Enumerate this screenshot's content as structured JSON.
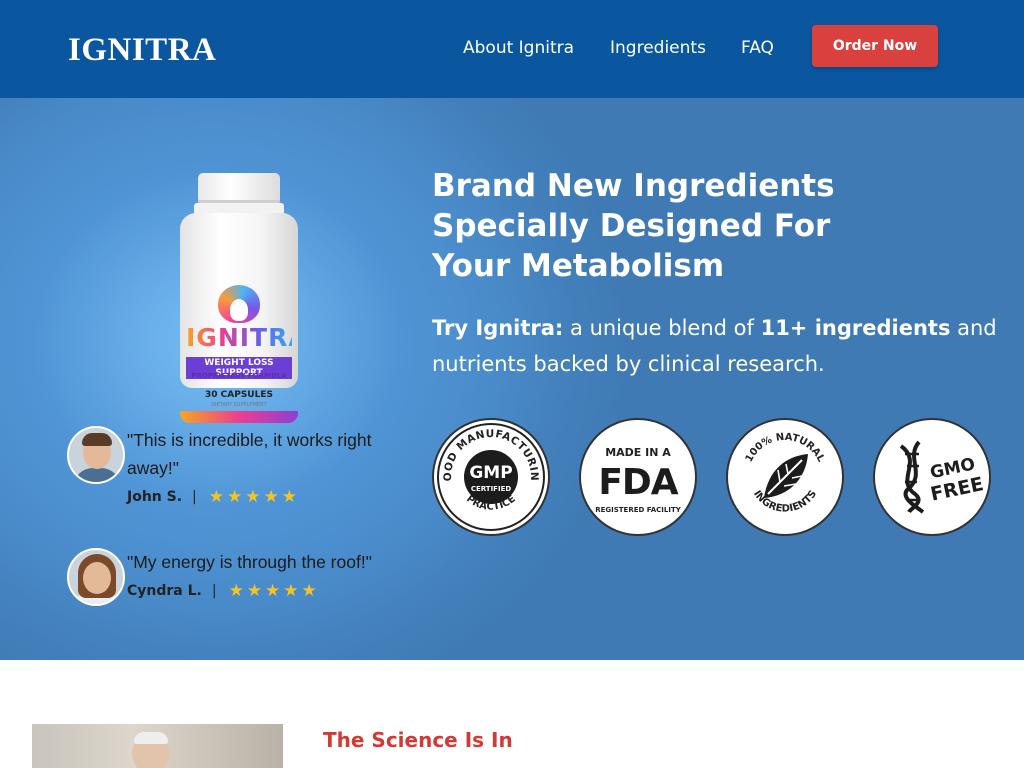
{
  "header": {
    "logo": "IGNITRA",
    "nav": [
      {
        "label": "About Ignitra"
      },
      {
        "label": "Ingredients"
      },
      {
        "label": "FAQ"
      }
    ],
    "cta_label": "Order Now"
  },
  "product": {
    "brand": "IGNITRA",
    "line1": "WEIGHT LOSS SUPPORT",
    "line2": "PROPRIETARY FORMULA",
    "capsules": "30 CAPSULES",
    "supplement": "DIETARY SUPPLEMENT"
  },
  "testimonials": [
    {
      "quote": "\"This is incredible, it works right away!\"",
      "author": "John S.",
      "separator": "|",
      "rating": 5,
      "stars": "★★★★★"
    },
    {
      "quote": "\"My energy is through the roof!\"",
      "author": "Cyndra L.",
      "separator": "|",
      "rating": 5,
      "stars": "★★★★★"
    }
  ],
  "hero": {
    "headline": "Brand New Ingredients Specially Designed For Your Metabolism",
    "lead_prefix": "Try Ignitra:",
    "lead_mid": " a unique blend of ",
    "lead_bold": "11+ ingredients",
    "lead_suffix": " and nutrients backed by clinical research."
  },
  "badges": [
    {
      "name": "gmp-certified-badge",
      "top_arc": "GOOD MANUFACTURING",
      "bottom_arc": "PRACTICE",
      "center_line1": "GMP",
      "center_line2": "CERTIFIED"
    },
    {
      "name": "fda-badge",
      "top_text": "MADE IN A",
      "center": "FDA",
      "bottom_text": "REGISTERED FACILITY"
    },
    {
      "name": "natural-ingredients-badge",
      "top_arc": "100% NATURAL",
      "bottom_arc": "INGREDIENTS"
    },
    {
      "name": "gmo-free-badge",
      "line1": "GMO",
      "line2": "FREE"
    }
  ],
  "science": {
    "title": "The Science Is In"
  },
  "colors": {
    "header_bg": "#0a57a0",
    "cta_bg": "#d9413e",
    "star": "#f6c324",
    "science_title": "#d23a35"
  }
}
